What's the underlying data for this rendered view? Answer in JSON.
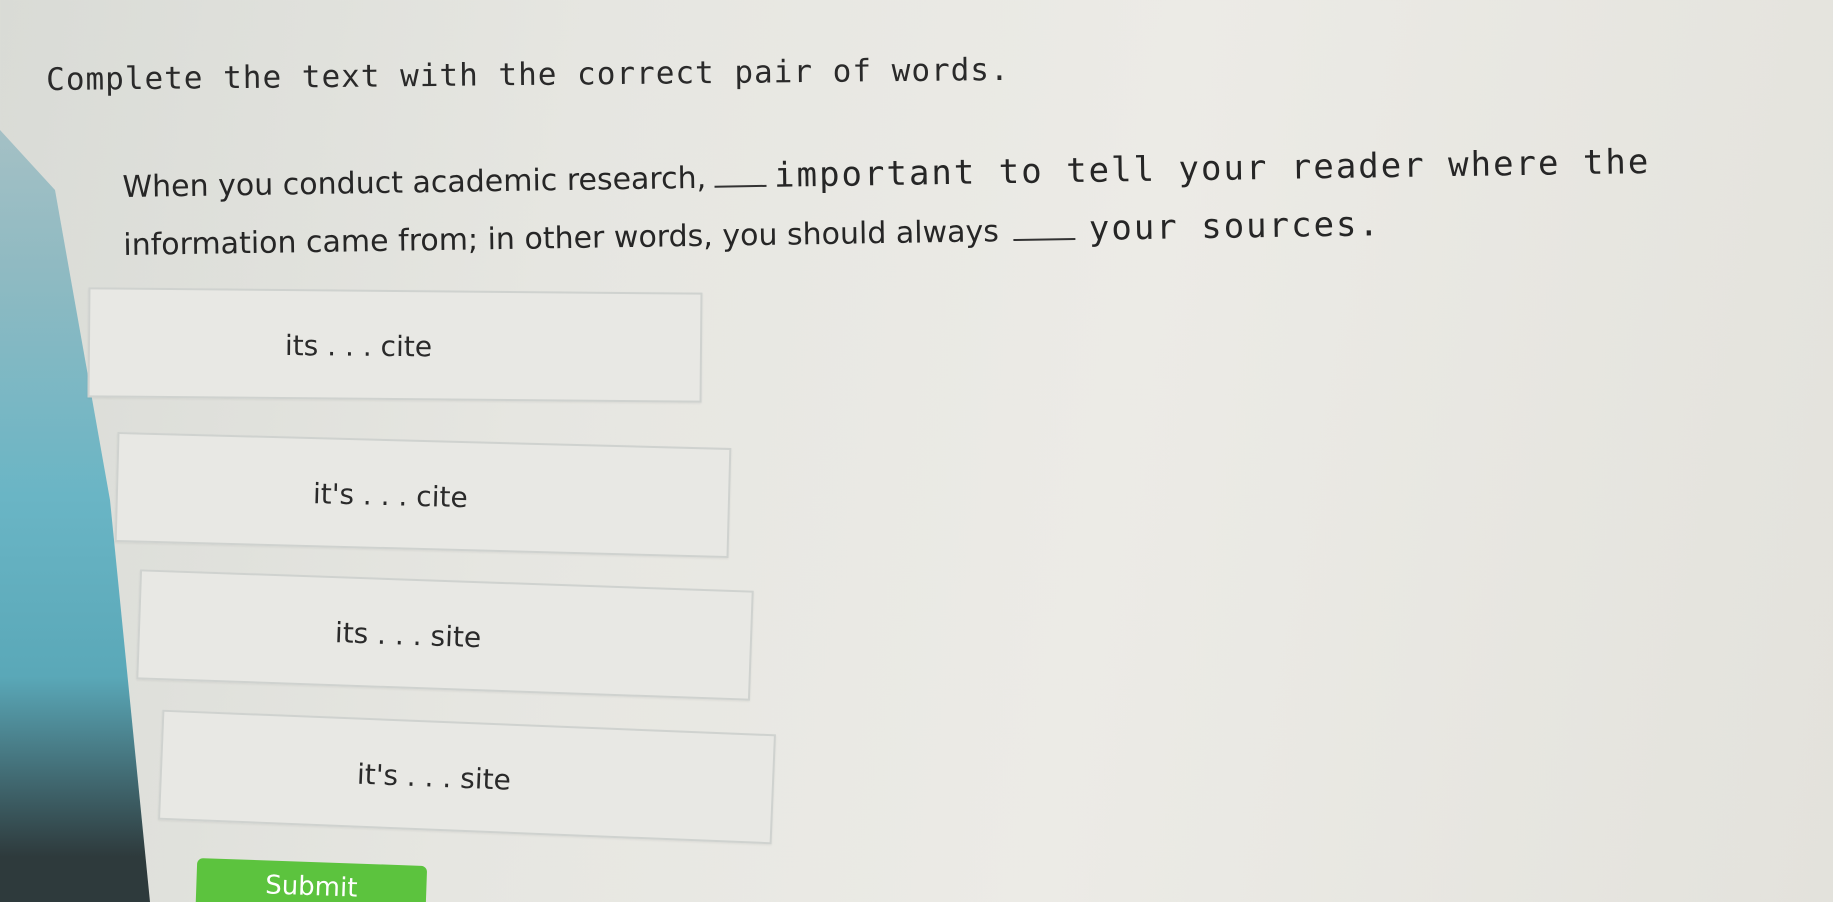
{
  "instruction": "Complete the text with the correct pair of words.",
  "question": {
    "part1": "When you conduct academic research,",
    "part2": "important to tell your reader where the",
    "part3": "information came from; in other words, you should always",
    "part4": "your sources."
  },
  "options": [
    {
      "label": "its . . . cite"
    },
    {
      "label": "it's . . . cite"
    },
    {
      "label": "its . . . site"
    },
    {
      "label": "it's . . . site"
    }
  ],
  "submit": {
    "label": "Submit"
  },
  "colors": {
    "submit_button": "#5cc33e",
    "accent_strip": "#6ab5c5"
  }
}
